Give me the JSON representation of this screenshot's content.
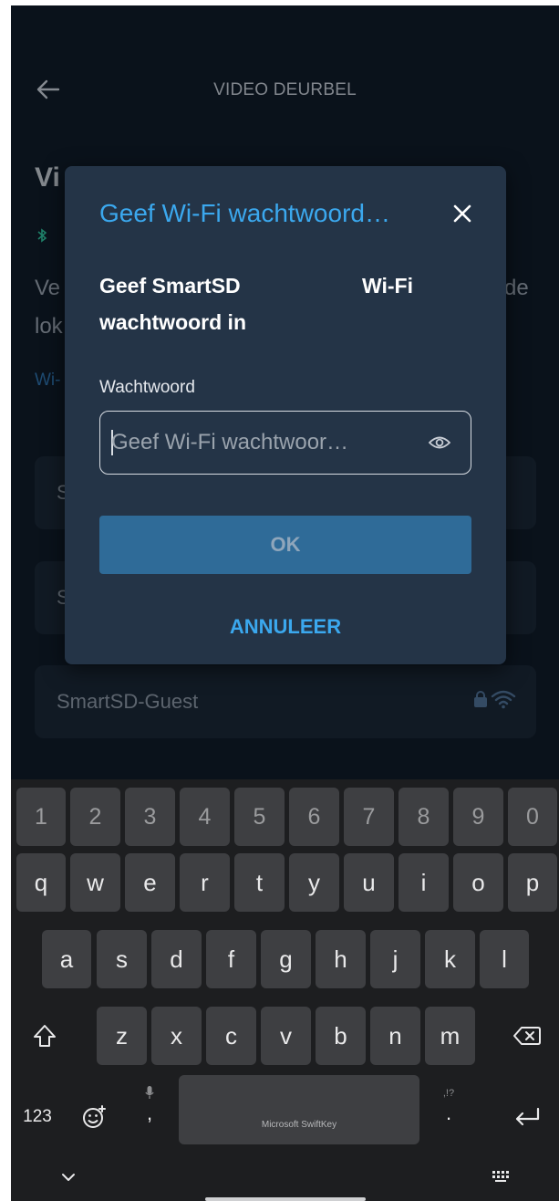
{
  "header": {
    "title": "VIDEO DEURBEL"
  },
  "background": {
    "heading": "Vi",
    "paragraph_line1_start": "Ve",
    "paragraph_line1_end": "de",
    "paragraph_line2": "lok",
    "link": "Wi-",
    "networks": [
      {
        "label": "S"
      },
      {
        "label": "S"
      },
      {
        "label": "SmartSD-Guest"
      }
    ]
  },
  "dialog": {
    "title": "Geef Wi-Fi wachtwoord…",
    "message_line1_left": "Geef SmartSD",
    "message_line1_right": "Wi-Fi",
    "message_line2": "wachtwoord in",
    "field_label": "Wachtwoord",
    "field_placeholder": "Geef Wi-Fi wachtwoor…",
    "ok_label": "OK",
    "cancel_label": "ANNULEER"
  },
  "keyboard": {
    "number_row": [
      "1",
      "2",
      "3",
      "4",
      "5",
      "6",
      "7",
      "8",
      "9",
      "0"
    ],
    "row1": [
      "q",
      "w",
      "e",
      "r",
      "t",
      "y",
      "u",
      "i",
      "o",
      "p"
    ],
    "row2": [
      "a",
      "s",
      "d",
      "f",
      "g",
      "h",
      "j",
      "k",
      "l"
    ],
    "row3": [
      "z",
      "x",
      "c",
      "v",
      "b",
      "n",
      "m"
    ],
    "mode_key": "123",
    "comma_key": ",",
    "period_key": ".",
    "punct_hint": ",!?",
    "space_label": "Microsoft SwiftKey"
  },
  "colors": {
    "accent": "#3ba8ee",
    "ok_button": "#2f6b98",
    "dialog_bg": "#243447",
    "bluetooth": "#2fc19a"
  }
}
